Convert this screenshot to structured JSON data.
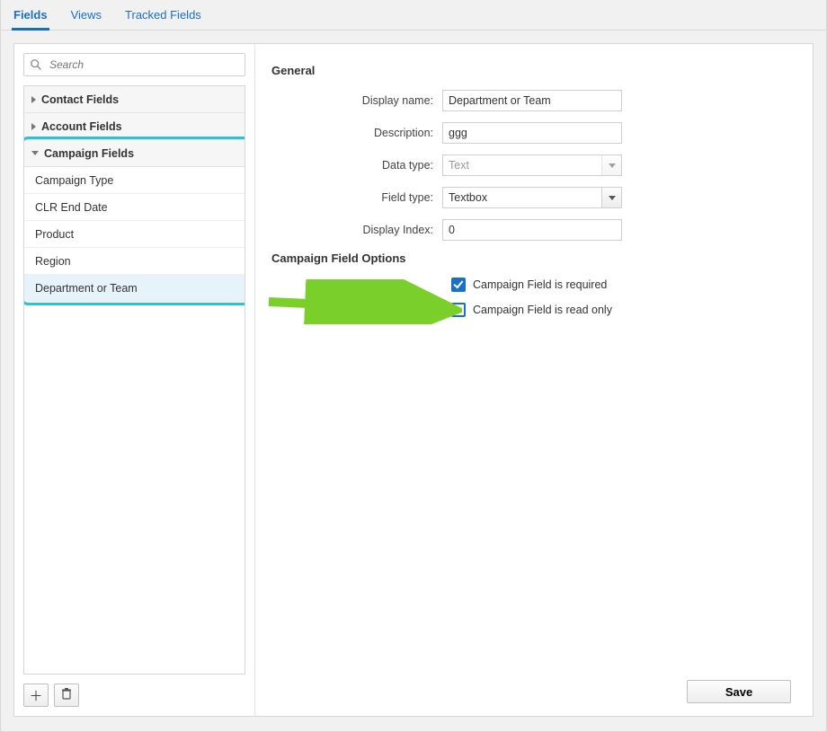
{
  "tabs": {
    "fields": "Fields",
    "views": "Views",
    "tracked": "Tracked Fields"
  },
  "sidebar": {
    "search_placeholder": "Search",
    "groups": {
      "contact": "Contact Fields",
      "account": "Account Fields",
      "campaign": "Campaign Fields"
    },
    "campaign_items": [
      "Campaign Type",
      "CLR End Date",
      "Product",
      "Region",
      "Department or Team"
    ]
  },
  "general": {
    "section": "General",
    "display_name_label": "Display name:",
    "display_name_value": "Department or Team",
    "description_label": "Description:",
    "description_value": "ggg",
    "data_type_label": "Data type:",
    "data_type_value": "Text",
    "field_type_label": "Field type:",
    "field_type_value": "Textbox",
    "display_index_label": "Display Index:",
    "display_index_value": "0"
  },
  "options": {
    "section": "Campaign Field Options",
    "required_label": "Campaign Field is required",
    "readonly_label": "Campaign Field is read only"
  },
  "save": "Save"
}
